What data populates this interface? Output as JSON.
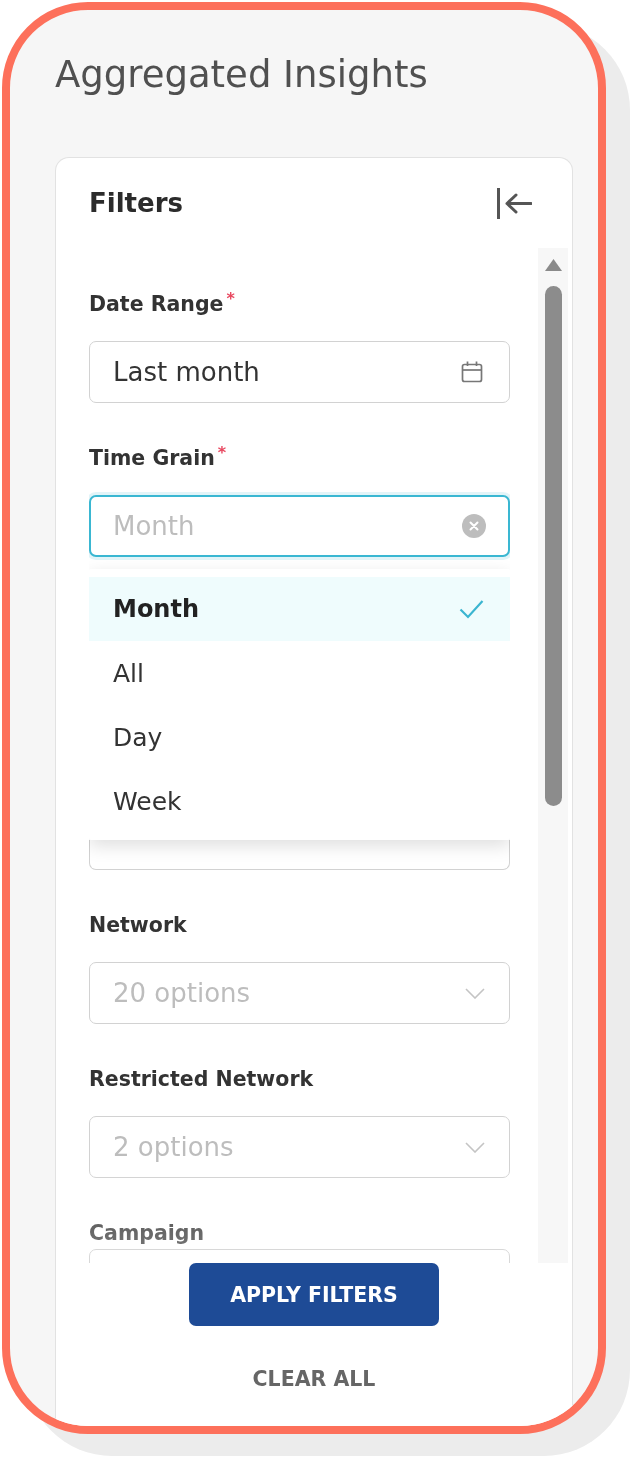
{
  "page": {
    "title": "Aggregated Insights"
  },
  "filters_panel": {
    "title": "Filters",
    "fields": [
      {
        "kind": "date",
        "label": "Date Range",
        "required_mark": "*",
        "value": "Last month",
        "focused": false
      },
      {
        "kind": "select",
        "label": "Time Grain",
        "required_mark": "*",
        "placeholder": "Month",
        "focused": true,
        "clearable": true,
        "open": true,
        "options": [
          {
            "label": "Month",
            "selected": true
          },
          {
            "label": "All",
            "selected": false
          },
          {
            "label": "Day",
            "selected": false
          },
          {
            "label": "Week",
            "selected": false
          }
        ]
      },
      {
        "kind": "select",
        "label": "Network",
        "placeholder": "20 options",
        "focused": false
      },
      {
        "kind": "select",
        "label": "Restricted Network",
        "placeholder": "2 options",
        "focused": false
      },
      {
        "kind": "select",
        "label": "Campaign",
        "focused": false
      }
    ],
    "buttons": [
      {
        "kind": "primary",
        "label": "APPLY FILTERS"
      },
      {
        "kind": "text",
        "label": "CLEAR ALL"
      }
    ]
  }
}
